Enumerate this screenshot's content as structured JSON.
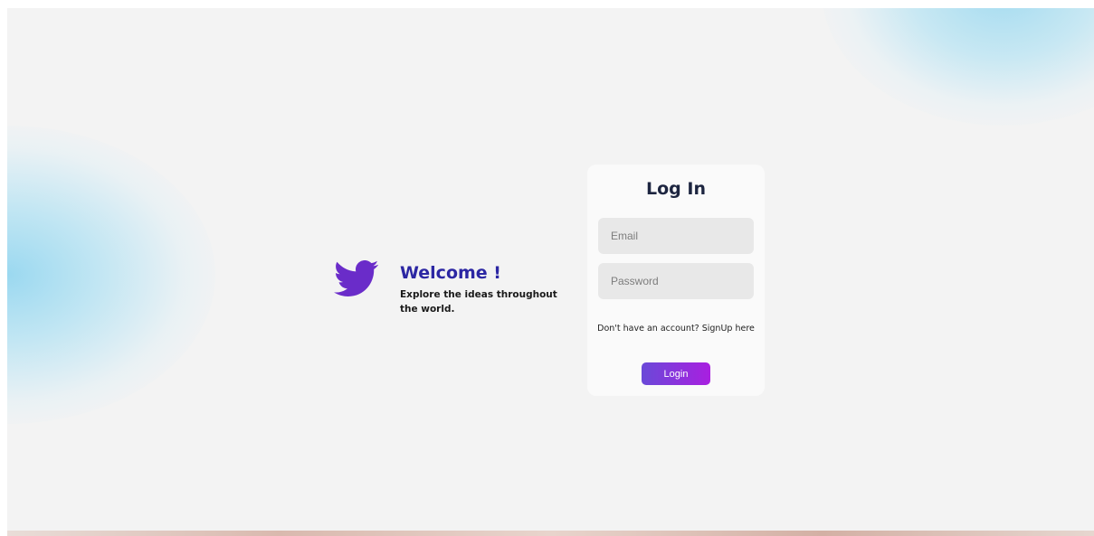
{
  "brand": {
    "logo_icon": "twitter-bird-icon",
    "logo_color": "#6a2cc9",
    "welcome_title": "Welcome !",
    "tagline": "Explore the ideas throughout the world."
  },
  "login_card": {
    "title": "Log In",
    "email_placeholder": "Email",
    "email_value": "",
    "password_placeholder": "Password",
    "password_value": "",
    "signup_prompt": "Don't have an account?",
    "signup_link": "SignUp here",
    "login_button": "Login"
  },
  "colors": {
    "page_background": "#f3f3f3",
    "card_background": "#fafafa",
    "input_background": "#e8e8e8",
    "title_color": "#1d2540",
    "welcome_color": "#2c27a3",
    "button_gradient_start": "#6a49d8",
    "button_gradient_end": "#a91fe0",
    "blob_color": "#9fd8f0"
  }
}
